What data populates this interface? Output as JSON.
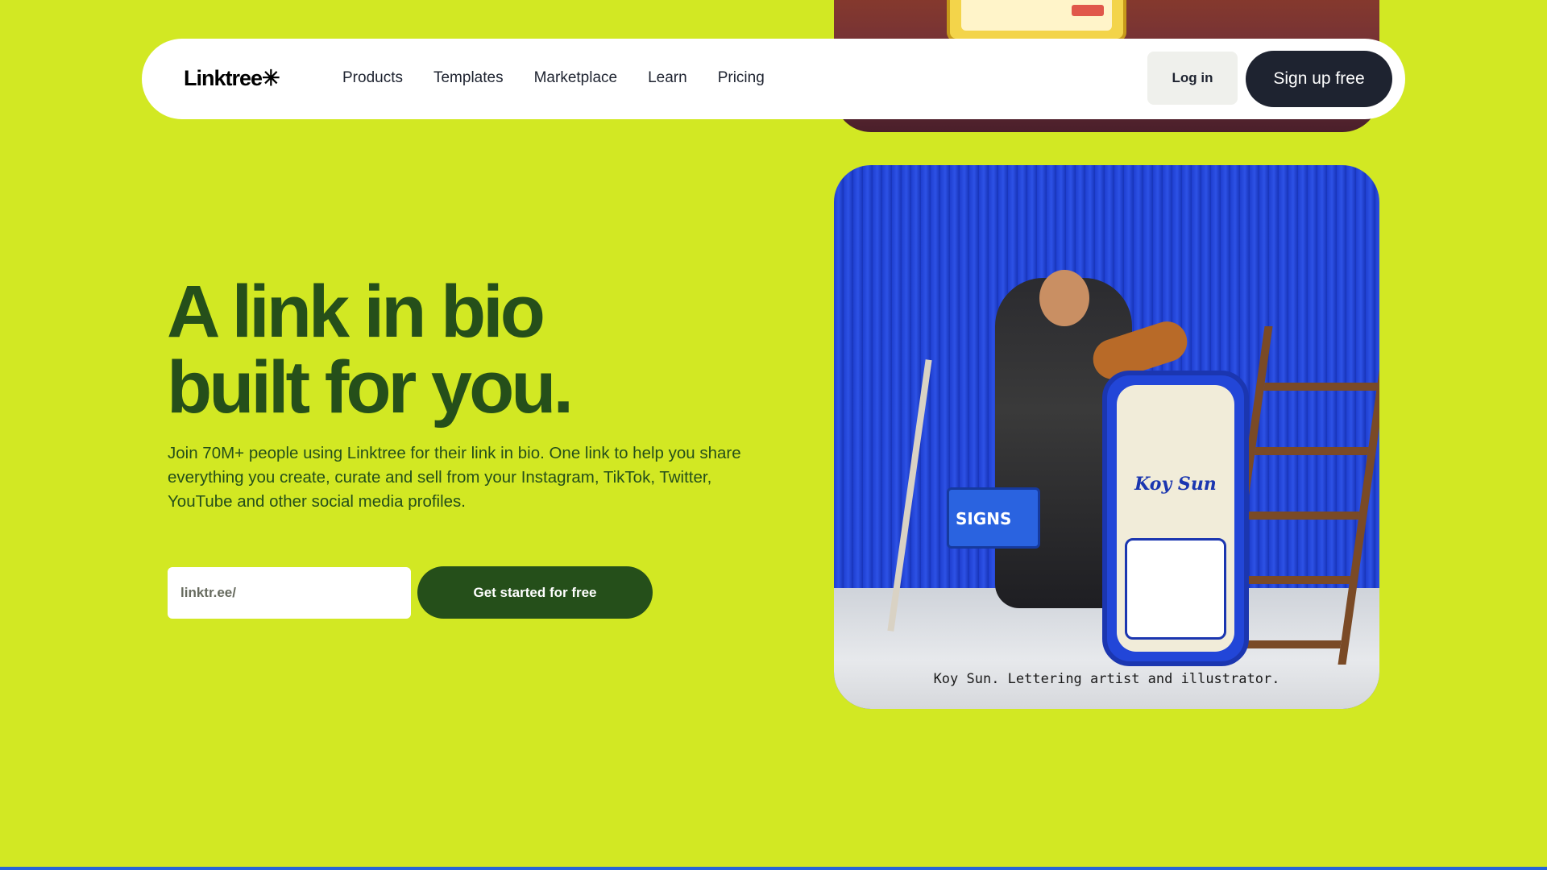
{
  "nav": {
    "logo": "Linktree✳",
    "links": [
      "Products",
      "Templates",
      "Marketplace",
      "Learn",
      "Pricing"
    ],
    "login_label": "Log in",
    "signup_label": "Sign up free"
  },
  "hero": {
    "title_line1": "A link in bio",
    "title_line2": "built for you.",
    "subtitle": "Join 70M+ people using Linktree for their link in bio. One link to help you share everything you create, curate and sell from your Instagram, TikTok, Twitter, YouTube and other social media profiles.",
    "input_placeholder": "linktr.ee/",
    "cta_label": "Get started for free"
  },
  "media": {
    "caption": "Koy Sun. Lettering artist and illustrator.",
    "phone_name": "Koy Sun",
    "basket_text": "SIGNS"
  },
  "colors": {
    "background": "#d2e823",
    "hero_text": "#254f1a",
    "nav_dark": "#1e2330"
  }
}
